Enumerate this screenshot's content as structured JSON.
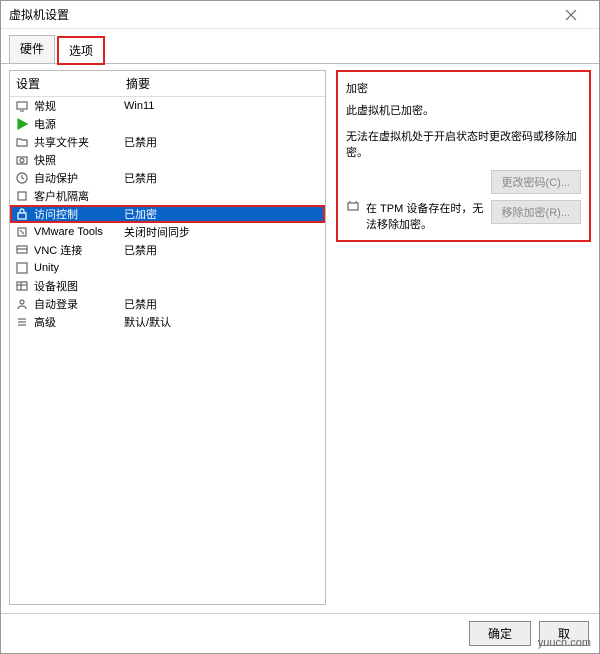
{
  "window": {
    "title": "虚拟机设置"
  },
  "tabs": [
    {
      "label": "硬件",
      "active": false
    },
    {
      "label": "选项",
      "active": true,
      "highlight": true
    }
  ],
  "list": {
    "headers": {
      "name": "设置",
      "summary": "摘要"
    },
    "items": [
      {
        "icon": "monitor-icon",
        "name": "常规",
        "summary": "Win11"
      },
      {
        "icon": "play-icon",
        "name": "电源",
        "summary": ""
      },
      {
        "icon": "folder-icon",
        "name": "共享文件夹",
        "summary": "已禁用"
      },
      {
        "icon": "camera-icon",
        "name": "快照",
        "summary": ""
      },
      {
        "icon": "clock-icon",
        "name": "自动保护",
        "summary": "已禁用"
      },
      {
        "icon": "plugin-icon",
        "name": "客户机隔离",
        "summary": ""
      },
      {
        "icon": "lock-icon",
        "name": "访问控制",
        "summary": "已加密",
        "selected": true,
        "highlight": true
      },
      {
        "icon": "tools-icon",
        "name": "VMware Tools",
        "summary": "关闭时间同步"
      },
      {
        "icon": "vnc-icon",
        "name": "VNC 连接",
        "summary": "已禁用"
      },
      {
        "icon": "unity-icon",
        "name": "Unity",
        "summary": ""
      },
      {
        "icon": "view-icon",
        "name": "设备视图",
        "summary": ""
      },
      {
        "icon": "login-icon",
        "name": "自动登录",
        "summary": "已禁用"
      },
      {
        "icon": "advanced-icon",
        "name": "高级",
        "summary": "默认/默认"
      }
    ]
  },
  "detail": {
    "section_title": "加密",
    "status": "此虚拟机已加密。",
    "note": "无法在虚拟机处于开启状态时更改密码或移除加密。",
    "btn_change": "更改密码(C)...",
    "btn_remove": "移除加密(R)...",
    "tpm_note": "在 TPM 设备存在时，无法移除加密。"
  },
  "footer": {
    "ok": "确定",
    "cancel": "取"
  },
  "watermark": "yuucn.com"
}
